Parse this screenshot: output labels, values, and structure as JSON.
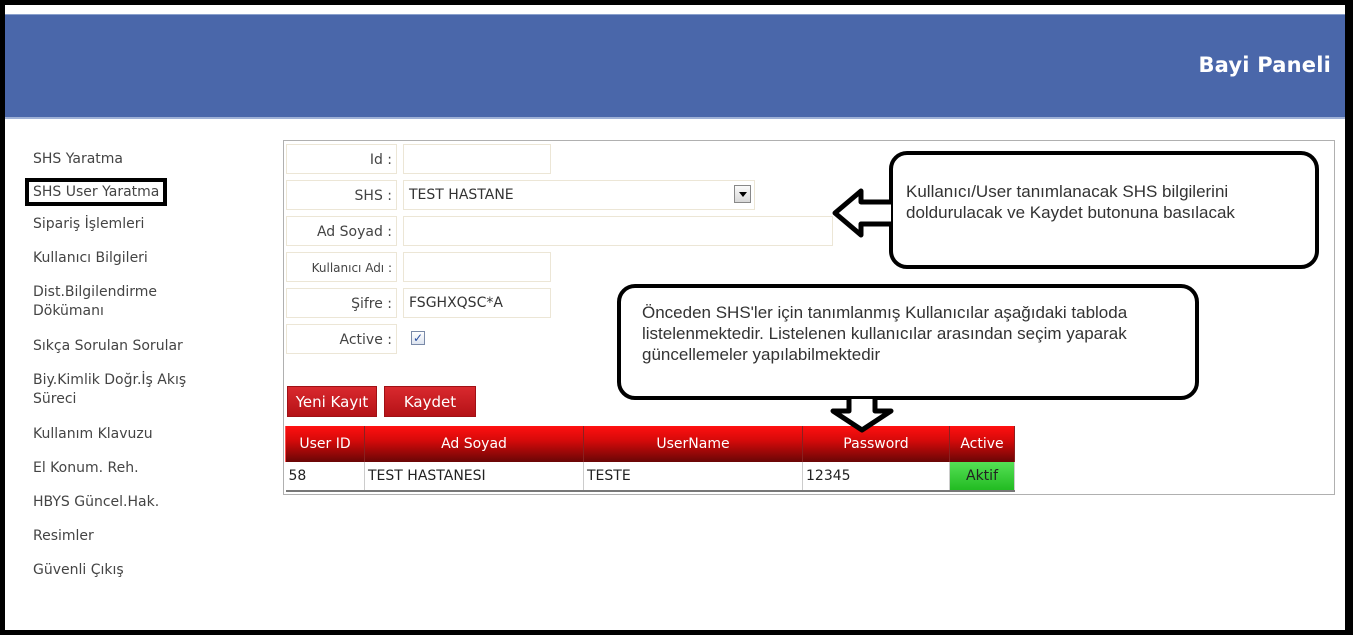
{
  "header": {
    "title": "Bayi Paneli",
    "bg_color": "#4a67aa"
  },
  "sidebar": {
    "items": [
      {
        "label": "SHS Yaratma"
      },
      {
        "label": "SHS User Yaratma",
        "active": true
      },
      {
        "label": "Sipariş İşlemleri"
      },
      {
        "label": "Kullanıcı Bilgileri"
      },
      {
        "label": "Dist.Bilgilendirme Dökümanı"
      },
      {
        "label": "Sıkça Sorulan Sorular"
      },
      {
        "label": "Biy.Kimlik Doğr.İş Akış Süreci"
      },
      {
        "label": "Kullanım Klavuzu"
      },
      {
        "label": "El Konum. Reh."
      },
      {
        "label": "HBYS Güncel.Hak."
      },
      {
        "label": "Resimler"
      },
      {
        "label": "Güvenli Çıkış"
      }
    ]
  },
  "form": {
    "id": {
      "label": "Id :",
      "value": ""
    },
    "shs": {
      "label": "SHS :",
      "value": "TEST HASTANE"
    },
    "ad_soyad": {
      "label": "Ad Soyad :",
      "value": ""
    },
    "kullanici_adi": {
      "label": "Kullanıcı Adı :",
      "value": ""
    },
    "sifre": {
      "label": "Şifre :",
      "value": "FSGHXQSC*A"
    },
    "active": {
      "label": "Active :",
      "checked": true,
      "mark": "✓"
    },
    "buttons": {
      "new": "Yeni Kayıt",
      "save": "Kaydet"
    }
  },
  "table": {
    "columns": [
      "User ID",
      "Ad Soyad",
      "UserName",
      "Password",
      "Active"
    ],
    "rows": [
      {
        "user_id": "58",
        "ad_soyad": "TEST HASTANESI",
        "username": "TESTE",
        "password": "12345",
        "active": "Aktif"
      }
    ]
  },
  "annotations": {
    "callout1": "Kullanıcı/User tanımlanacak SHS bilgilerini doldurulacak ve Kaydet butonuna basılacak",
    "callout2": "Önceden SHS'ler için tanımlanmış Kullanıcılar aşağıdaki tabloda listelenmektedir. Listelenen kullanıcılar arasından seçim yaparak güncellemeler yapılabilmektedir"
  }
}
